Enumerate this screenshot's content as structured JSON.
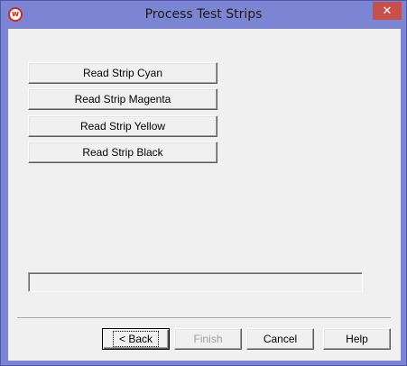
{
  "window": {
    "title": "Process Test Strips",
    "icon": "w-logo-icon",
    "close_glyph": "✕"
  },
  "strip_buttons": [
    {
      "label": "Read Strip Cyan"
    },
    {
      "label": "Read Strip Magenta"
    },
    {
      "label": "Read Strip Yellow"
    },
    {
      "label": "Read Strip Black"
    }
  ],
  "progress": {
    "value": 0
  },
  "footer": {
    "back_label": "< Back",
    "finish_label": "Finish",
    "cancel_label": "Cancel",
    "help_label": "Help"
  },
  "colors": {
    "titlebar": "#7c84d4",
    "close_button": "#c7504a",
    "dialog_background": "#f0f0f0"
  }
}
